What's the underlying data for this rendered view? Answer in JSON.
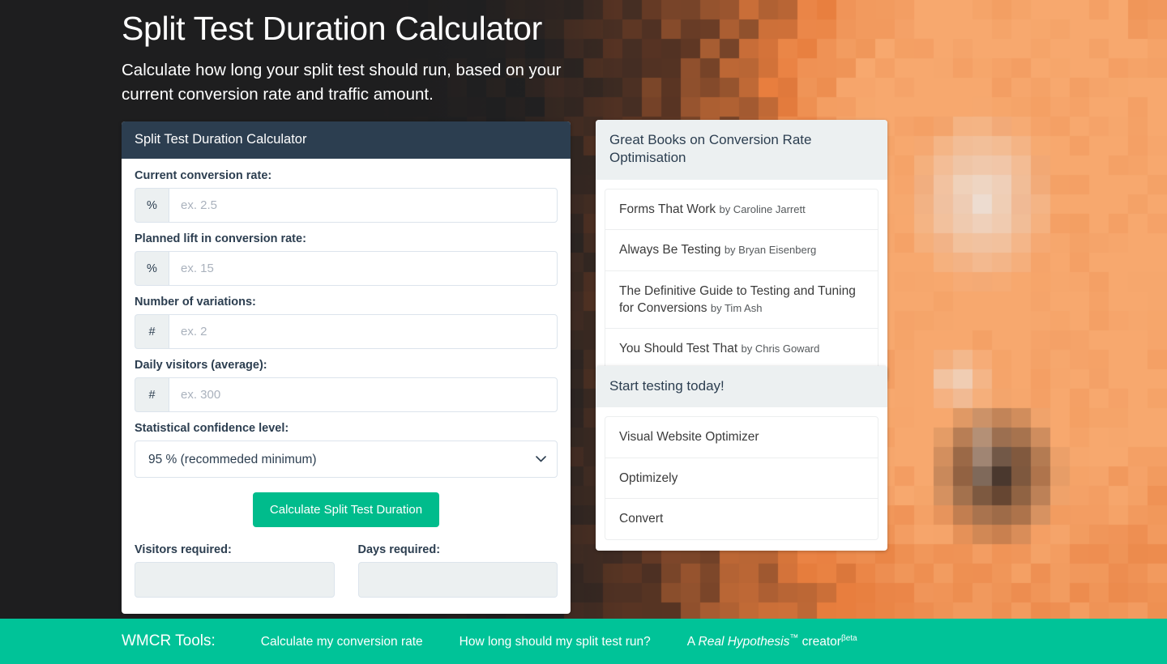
{
  "header": {
    "title": "Split Test Duration Calculator",
    "subtitle": "Calculate how long your split test should run, based on your current conversion rate and traffic amount."
  },
  "calculator": {
    "panel_title": "Split Test Duration Calculator",
    "fields": [
      {
        "label": "Current conversion rate:",
        "addon": "%",
        "placeholder": "ex. 2.5",
        "value": ""
      },
      {
        "label": "Planned lift in conversion rate:",
        "addon": "%",
        "placeholder": "ex. 15",
        "value": ""
      },
      {
        "label": "Number of variations:",
        "addon": "#",
        "placeholder": "ex. 2",
        "value": ""
      },
      {
        "label": "Daily visitors (average):",
        "addon": "#",
        "placeholder": "ex. 300",
        "value": ""
      }
    ],
    "confidence": {
      "label": "Statistical confidence level:",
      "selected": "95 % (recommeded minimum)",
      "caret_icon": "chevron-down-icon"
    },
    "submit_label": "Calculate Split Test Duration",
    "results": [
      {
        "label": "Visitors required:",
        "value": ""
      },
      {
        "label": "Days required:",
        "value": ""
      }
    ]
  },
  "sidebar": {
    "books_panel": {
      "title": "Great Books on Conversion Rate Optimisation",
      "items": [
        {
          "title": "Forms That Work",
          "byline": "by Caroline Jarrett"
        },
        {
          "title": "Always Be Testing",
          "byline": "by Bryan Eisenberg"
        },
        {
          "title": "The Definitive Guide to Testing and Tuning for Conversions",
          "byline": "by Tim Ash"
        },
        {
          "title": "You Should Test That",
          "byline": "by Chris Goward"
        }
      ]
    },
    "tools_panel": {
      "title": "Start testing today!",
      "items": [
        {
          "title": "Visual Website Optimizer"
        },
        {
          "title": "Optimizely"
        },
        {
          "title": "Convert"
        }
      ]
    }
  },
  "footer": {
    "brand": "WMCR Tools:",
    "links": [
      {
        "text": "Calculate my conversion rate"
      },
      {
        "text": "How long should my split test run?"
      }
    ],
    "hypothesis_link": {
      "prefix": "A ",
      "italic": "Real Hypothesis",
      "tm": "™",
      "suffix": " creator",
      "sup": "βeta"
    }
  },
  "colors": {
    "panel_header": "#2c3e50",
    "accent_teal": "#00bc8c",
    "footer_teal": "#00c398",
    "sidebar_header": "#ecf0f1",
    "page_dark": "#232323"
  }
}
